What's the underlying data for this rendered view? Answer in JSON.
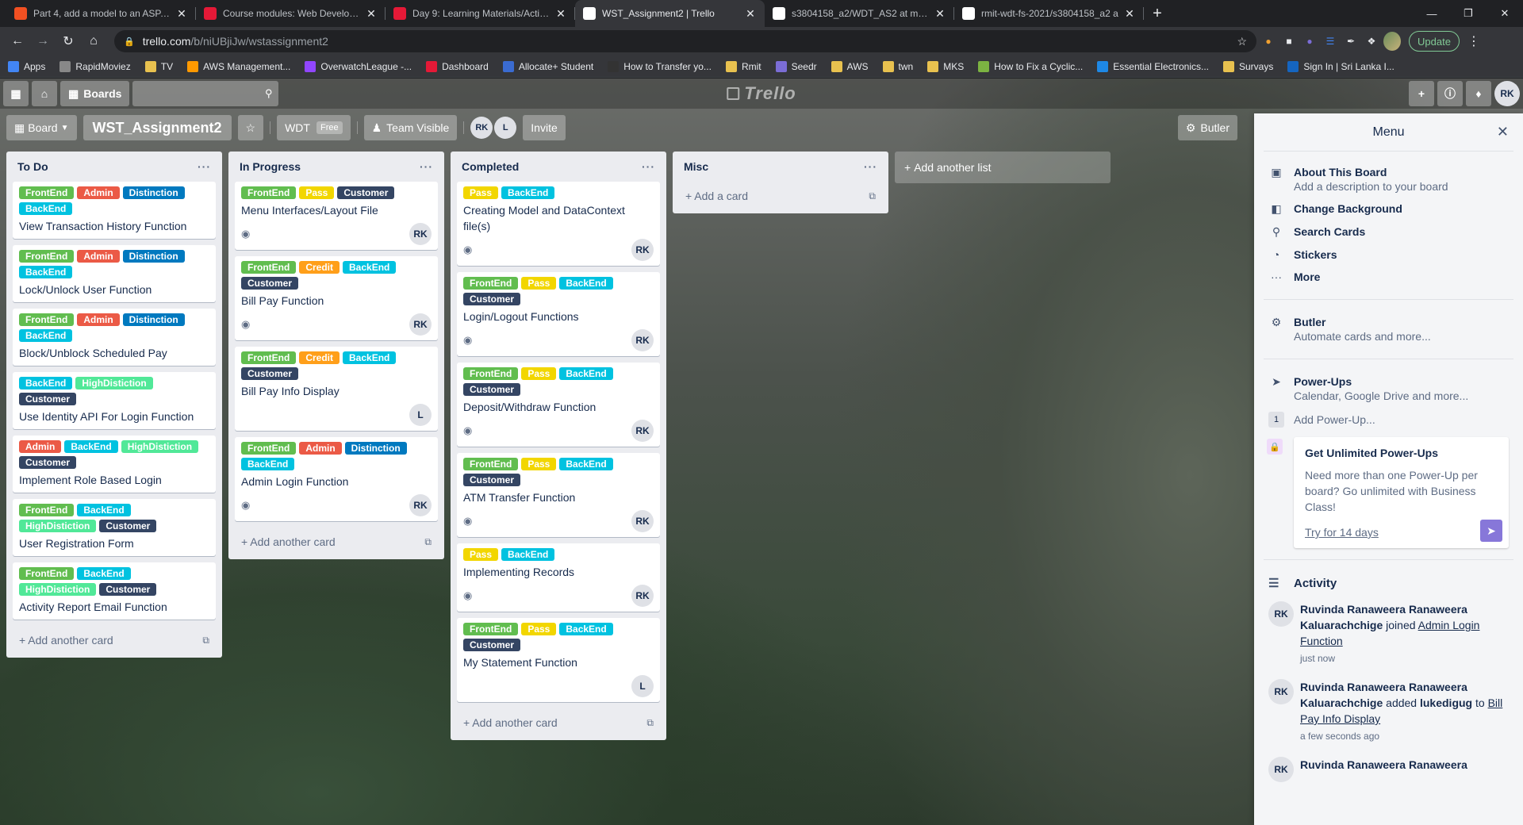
{
  "browser": {
    "tabs": [
      {
        "title": "Part 4, add a model to an ASP.NE",
        "color": "#f25022",
        "active": false
      },
      {
        "title": "Course modules: Web Developm",
        "color": "#e51937",
        "active": false
      },
      {
        "title": "Day 9: Learning Materials/Activiti",
        "color": "#e51937",
        "active": false
      },
      {
        "title": "WST_Assignment2 | Trello",
        "color": "#ffffff",
        "active": true
      },
      {
        "title": "s3804158_a2/WDT_AS2 at maste",
        "color": "#ffffff",
        "active": false
      },
      {
        "title": "rmit-wdt-fs-2021/s3804158_a2 a",
        "color": "#ffffff",
        "active": false
      }
    ],
    "url_host": "trello.com",
    "url_path": "/b/niUBjiJw/wstassignment2",
    "update_label": "Update",
    "bookmarks": [
      {
        "label": "Apps",
        "color": "#4285f4"
      },
      {
        "label": "RapidMoviez",
        "color": "#888888"
      },
      {
        "label": "TV",
        "color": "#e8c14f"
      },
      {
        "label": "AWS Management...",
        "color": "#ff9900"
      },
      {
        "label": "OverwatchLeague -...",
        "color": "#9146ff"
      },
      {
        "label": "Dashboard",
        "color": "#e51937"
      },
      {
        "label": "Allocate+ Student",
        "color": "#3a6bd1"
      },
      {
        "label": "How to Transfer yo...",
        "color": "#333333"
      },
      {
        "label": "Rmit",
        "color": "#e8c14f"
      },
      {
        "label": "Seedr",
        "color": "#7b6dd6"
      },
      {
        "label": "AWS",
        "color": "#e8c14f"
      },
      {
        "label": "twn",
        "color": "#e8c14f"
      },
      {
        "label": "MKS",
        "color": "#e8c14f"
      },
      {
        "label": "How to Fix a Cyclic...",
        "color": "#7cb342"
      },
      {
        "label": "Essential Electronics...",
        "color": "#1e88e5"
      },
      {
        "label": "Survays",
        "color": "#e8c14f"
      },
      {
        "label": "Sign In | Sri Lanka I...",
        "color": "#1565c0"
      }
    ]
  },
  "trello": {
    "header": {
      "boards_label": "Boards",
      "logo": "Trello",
      "user_initials": "RK"
    },
    "board": {
      "view_label": "Board",
      "name": "WST_Assignment2",
      "team": "WDT",
      "team_badge": "Free",
      "visibility": "Team Visible",
      "members": [
        "RK",
        "L"
      ],
      "invite_label": "Invite",
      "butler_label": "Butler"
    },
    "label_colors": {
      "FrontEnd": "#61bd4f",
      "Admin": "#eb5a46",
      "Distinction": "#0079bf",
      "BackEnd": "#00c2e0",
      "HighDistiction": "#51e898",
      "Customer": "#344563",
      "Pass": "#f2d600",
      "Credit": "#ff9f1a"
    },
    "lists": [
      {
        "name": "To Do",
        "add_label": "Add another card",
        "cards": [
          {
            "labels": [
              "FrontEnd",
              "Admin",
              "Distinction",
              "BackEnd"
            ],
            "title": "View Transaction History Function",
            "watch": false,
            "member": ""
          },
          {
            "labels": [
              "FrontEnd",
              "Admin",
              "Distinction",
              "BackEnd"
            ],
            "title": "Lock/Unlock User Function",
            "watch": false,
            "member": ""
          },
          {
            "labels": [
              "FrontEnd",
              "Admin",
              "Distinction",
              "BackEnd"
            ],
            "title": "Block/Unblock Scheduled Pay",
            "watch": false,
            "member": ""
          },
          {
            "labels": [
              "BackEnd",
              "HighDistiction",
              "Customer"
            ],
            "title": "Use Identity API For Login Function",
            "watch": false,
            "member": ""
          },
          {
            "labels": [
              "Admin",
              "BackEnd",
              "HighDistiction",
              "Customer"
            ],
            "title": "Implement Role Based Login",
            "watch": false,
            "member": ""
          },
          {
            "labels": [
              "FrontEnd",
              "BackEnd",
              "HighDistiction",
              "Customer"
            ],
            "title": "User Registration Form",
            "watch": false,
            "member": ""
          },
          {
            "labels": [
              "FrontEnd",
              "BackEnd",
              "HighDistiction",
              "Customer"
            ],
            "title": "Activity Report Email Function",
            "watch": false,
            "member": ""
          }
        ]
      },
      {
        "name": "In Progress",
        "add_label": "Add another card",
        "cards": [
          {
            "labels": [
              "FrontEnd",
              "Pass",
              "Customer"
            ],
            "title": "Menu Interfaces/Layout File",
            "watch": true,
            "member": "RK"
          },
          {
            "labels": [
              "FrontEnd",
              "Credit",
              "BackEnd",
              "Customer"
            ],
            "title": "Bill Pay Function",
            "watch": true,
            "member": "RK"
          },
          {
            "labels": [
              "FrontEnd",
              "Credit",
              "BackEnd",
              "Customer"
            ],
            "title": "Bill Pay Info Display",
            "watch": false,
            "member": "L"
          },
          {
            "labels": [
              "FrontEnd",
              "Admin",
              "Distinction",
              "BackEnd"
            ],
            "title": "Admin Login Function",
            "watch": true,
            "member": "RK"
          }
        ]
      },
      {
        "name": "Completed",
        "add_label": "Add another card",
        "cards": [
          {
            "labels": [
              "Pass",
              "BackEnd"
            ],
            "title": "Creating Model and DataContext file(s)",
            "watch": true,
            "member": "RK"
          },
          {
            "labels": [
              "FrontEnd",
              "Pass",
              "BackEnd",
              "Customer"
            ],
            "title": "Login/Logout Functions",
            "watch": true,
            "member": "RK"
          },
          {
            "labels": [
              "FrontEnd",
              "Pass",
              "BackEnd",
              "Customer"
            ],
            "title": "Deposit/Withdraw Function",
            "watch": true,
            "member": "RK"
          },
          {
            "labels": [
              "FrontEnd",
              "Pass",
              "BackEnd",
              "Customer"
            ],
            "title": "ATM Transfer Function",
            "watch": true,
            "member": "RK"
          },
          {
            "labels": [
              "Pass",
              "BackEnd"
            ],
            "title": "Implementing Records",
            "watch": true,
            "member": "RK"
          },
          {
            "labels": [
              "FrontEnd",
              "Pass",
              "BackEnd",
              "Customer"
            ],
            "title": "My Statement Function",
            "watch": false,
            "member": "L"
          }
        ]
      },
      {
        "name": "Misc",
        "add_label": "Add a card",
        "cards": []
      }
    ],
    "add_list_label": "Add another list",
    "menu": {
      "title": "Menu",
      "items": [
        {
          "icon": "board-icon",
          "title": "About This Board",
          "sub": "Add a description to your board"
        },
        {
          "icon": "background-icon",
          "title": "Change Background",
          "sub": ""
        },
        {
          "icon": "search-icon",
          "title": "Search Cards",
          "sub": ""
        },
        {
          "icon": "sticker-icon",
          "title": "Stickers",
          "sub": ""
        },
        {
          "icon": "more-icon",
          "title": "More",
          "sub": ""
        }
      ],
      "butler": {
        "title": "Butler",
        "sub": "Automate cards and more..."
      },
      "powerups": {
        "title": "Power-Ups",
        "sub": "Calendar, Google Drive and more...",
        "count": "1",
        "add_label": "Add Power-Up..."
      },
      "promo": {
        "title": "Get Unlimited Power-Ups",
        "text": "Need more than one Power-Up per board? Go unlimited with Business Class!",
        "link": "Try for 14 days"
      },
      "activity_title": "Activity",
      "activity": [
        {
          "initials": "RK",
          "user": "Ruvinda Ranaweera Ranaweera Kaluarachchige",
          "action": " joined ",
          "target": "Admin Login Function",
          "extra": "",
          "extra_target": "",
          "time": "just now"
        },
        {
          "initials": "RK",
          "user": "Ruvinda Ranaweera Ranaweera Kaluarachchige",
          "action": " added ",
          "target": "lukedigug",
          "extra": " to ",
          "extra_target": "Bill Pay Info Display",
          "time": "a few seconds ago"
        },
        {
          "initials": "RK",
          "user": "Ruvinda Ranaweera Ranaweera",
          "action": "",
          "target": "",
          "extra": "",
          "extra_target": "",
          "time": ""
        }
      ]
    }
  }
}
